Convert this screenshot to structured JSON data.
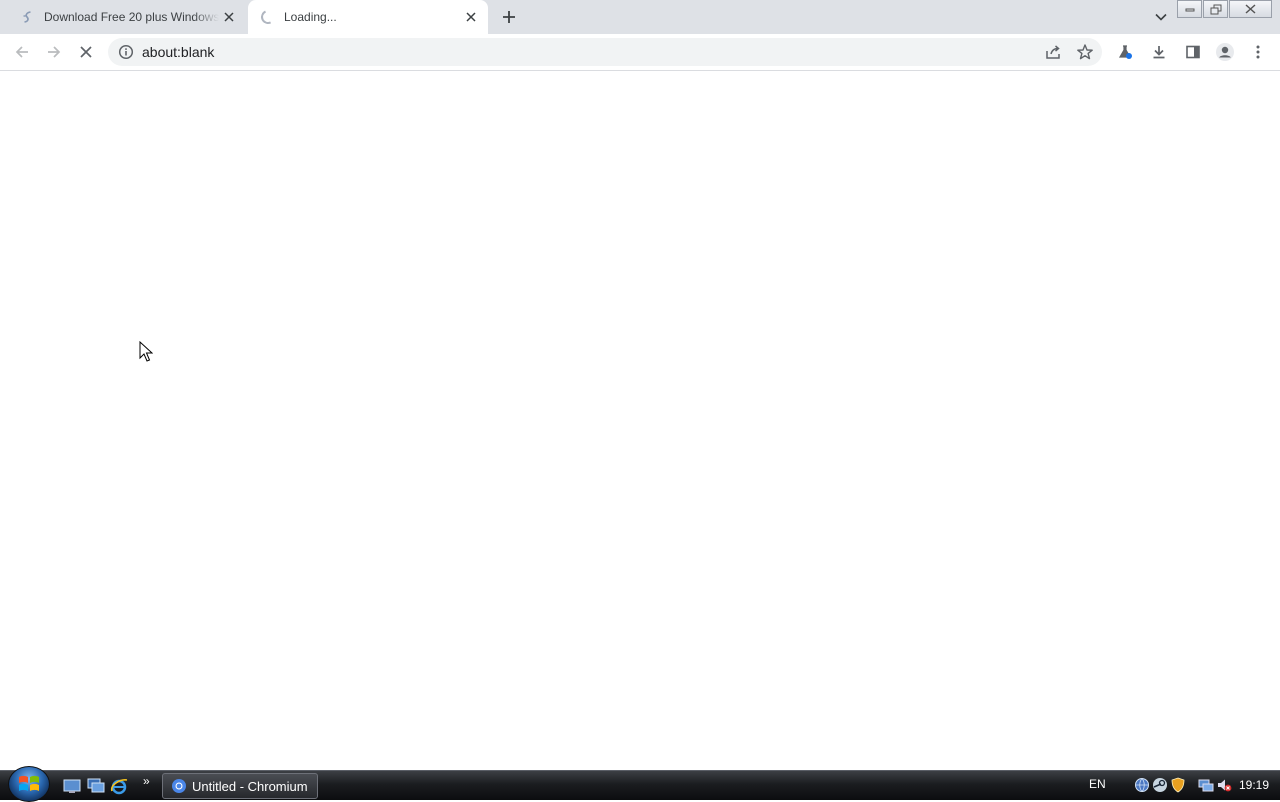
{
  "browser": {
    "tabs": [
      {
        "title": "Download Free 20 plus Windows",
        "state": "inactive"
      },
      {
        "title": "Loading...",
        "state": "active"
      }
    ],
    "address_bar": {
      "url": "about:blank"
    }
  },
  "taskbar": {
    "active_window": "Untitled - Chromium",
    "language": "EN",
    "clock": "19:19"
  },
  "colors": {
    "tabstrip_bg": "#dee1e6",
    "omnibox_bg": "#f1f3f4",
    "icon_gray": "#5f6368"
  }
}
